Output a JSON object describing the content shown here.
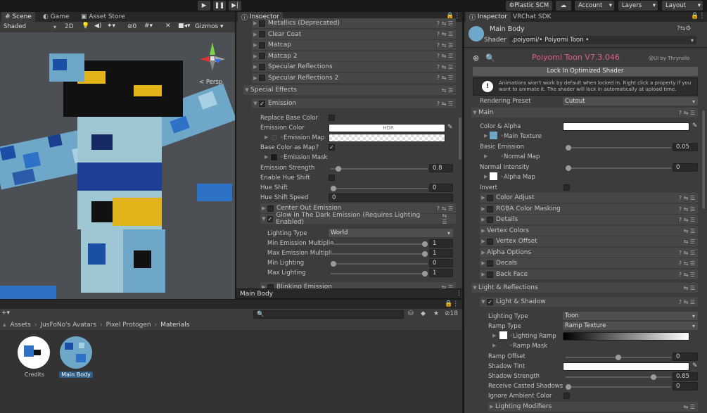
{
  "toolbar": {
    "plastic": "Plastic SCM",
    "account": "Account",
    "layers": "Layers",
    "layout": "Layout"
  },
  "scene": {
    "tabs": [
      "Scene",
      "Game",
      "Asset Store"
    ],
    "shading": "Shaded",
    "mode2d": "2D",
    "gizmos": "Gizmos",
    "persp": "< Persp",
    "hidden_count": "0"
  },
  "inspector_mid": {
    "tab": "Inspector",
    "footer": "Main Body",
    "sections": [
      "Metallics (Deprecated)",
      "Clear Coat",
      "Matcap",
      "Matcap 2",
      "Specular Reflections",
      "Specular Reflections 2"
    ],
    "special": "Special Effects",
    "emission": "Emission",
    "fields": [
      {
        "label": "Replace Base Color"
      },
      {
        "label": "Emission Color",
        "value": "HDR"
      },
      {
        "label": "Emission Map"
      },
      {
        "label": "Base Color as Map?"
      },
      {
        "label": "Emission Mask"
      },
      {
        "label": "Emission Strength",
        "value": "0.8"
      },
      {
        "label": "Enable Hue Shift"
      },
      {
        "label": "Hue Shift",
        "value": "0"
      },
      {
        "label": "Hue Shift Speed",
        "value": "0"
      }
    ],
    "center_out": "Center Out Emission",
    "glow": "Glow In The Dark Emission (Requires Lighting Enabled)",
    "glow_fields": [
      {
        "label": "Lighting Type",
        "value": "World"
      },
      {
        "label": "Min Emission Multiplie",
        "value": "1"
      },
      {
        "label": "Max Emission Multipli",
        "value": "1"
      },
      {
        "label": "Min Lighting",
        "value": "0"
      },
      {
        "label": "Max Lighting",
        "value": "1"
      }
    ],
    "blinking": "Blinking Emission"
  },
  "project": {
    "breadcrumb": [
      "Assets",
      "JusFoNo's Avatars",
      "Pixel Protogen",
      "Materials"
    ],
    "items": [
      "Credits",
      "Main Body"
    ],
    "count": "18"
  },
  "inspector_right": {
    "tabs": [
      "Inspector",
      "VRChat SDK"
    ],
    "material": "Main Body",
    "shader_label": "Shader",
    "shader": ".poiyomi/• Poiyomi Toon •",
    "title": "Poiyomi Toon V7.3.046",
    "credit": "@UI by Thryrallo",
    "lock": "Lock In Optimized Shader",
    "warning": "Animations won't work by default when locked in. Right click a property if you want to animate it. The shader will lock in automatically at upload time.",
    "preset_label": "Rendering Preset",
    "preset": "Cutout",
    "main": "Main",
    "main_fields": [
      {
        "label": "Color & Alpha"
      },
      {
        "label": "Main Texture"
      },
      {
        "label": "Basic Emission",
        "value": "0.05"
      },
      {
        "label": "Normal Map"
      },
      {
        "label": "Normal Intensity",
        "value": "0"
      },
      {
        "label": "Alpha Map"
      },
      {
        "label": "Invert"
      }
    ],
    "sub": [
      "Color Adjust",
      "RGBA Color Masking",
      "Details",
      "Vertex Colors",
      "Vertex Offset",
      "Alpha Options",
      "Decals",
      "Back Face"
    ],
    "lr": "Light & Reflections",
    "ls": "Light & Shadow",
    "ls_fields": [
      {
        "label": "Lighting Type",
        "value": "Toon"
      },
      {
        "label": "Ramp Type",
        "value": "Ramp Texture"
      },
      {
        "label": "Lighting Ramp"
      },
      {
        "label": "Ramp Mask"
      },
      {
        "label": "Ramp Offset",
        "value": "0"
      },
      {
        "label": "Shadow Tint"
      },
      {
        "label": "Shadow Strength",
        "value": "0.85"
      },
      {
        "label": "Receive Casted Shadows",
        "value": "0"
      },
      {
        "label": "Ignore Ambient Color"
      }
    ],
    "modifiers": "Lighting Modifiers"
  }
}
